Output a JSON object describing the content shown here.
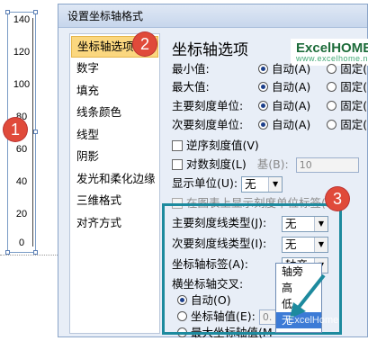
{
  "chart": {
    "ticks": [
      "140",
      "120",
      "100",
      "80",
      "60",
      "40",
      "20",
      "0"
    ]
  },
  "badges": [
    "1",
    "2",
    "3"
  ],
  "dialog": {
    "title": "设置坐标轴格式",
    "nav": [
      "坐标轴选项",
      "数字",
      "填充",
      "线条颜色",
      "线型",
      "阴影",
      "发光和柔化边缘",
      "三维格式",
      "对齐方式"
    ],
    "panel": {
      "heading": "坐标轴选项",
      "logo": {
        "main": "ExcelHOME",
        "sub": "www.excelhome.net"
      },
      "min_label": "最小值:",
      "max_label": "最大值:",
      "major_label": "主要刻度单位:",
      "minor_label": "次要刻度单位:",
      "auto": "自动(A)",
      "fixed": "固定(F",
      "reverse": "逆序刻度值(V)",
      "log": "对数刻度(L)",
      "base_label": "基(B):",
      "base_value": "10",
      "display_units_label": "显示单位(U):",
      "display_units_value": "无",
      "show_units_label": "在图表上显示刻度单位标签(S",
      "major_tick_label": "主要刻度线类型(J):",
      "major_tick_value": "无",
      "minor_tick_label": "次要刻度线类型(I):",
      "minor_tick_value": "无",
      "axis_labels_label": "坐标轴标签(A):",
      "axis_labels_value": "轴旁",
      "cross_label": "横坐标轴交叉:",
      "cross_auto": "自动(O)",
      "cross_value_label": "坐标轴值(E):",
      "cross_value": "0.",
      "cross_max_label": "最大坐标轴值(M"
    },
    "dropdown_options": [
      "轴旁",
      "高",
      "低",
      "无"
    ],
    "watermark": "ExcelHome"
  }
}
